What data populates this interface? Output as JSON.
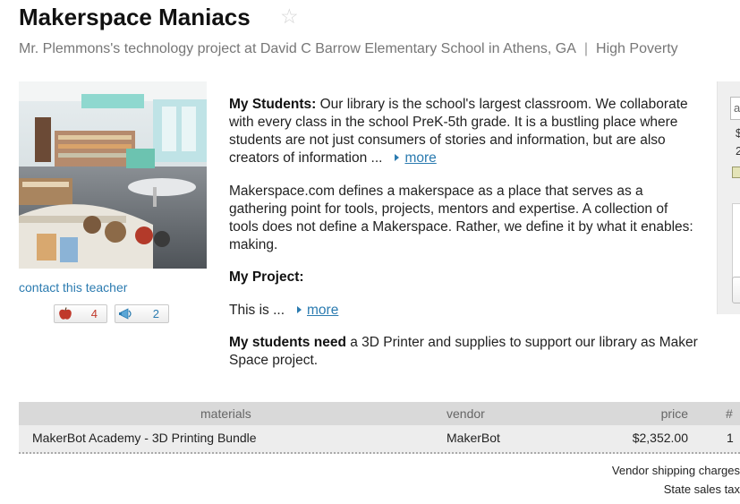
{
  "project": {
    "title": "Makerspace Maniacs",
    "subtitle": "Mr. Plemmons's technology project at David C Barrow Elementary School in Athens, GA",
    "poverty": "High Poverty"
  },
  "teacher": {
    "contact_label": "contact this teacher",
    "apples_count": "4",
    "shares_count": "2"
  },
  "description": {
    "students_heading": "My Students:",
    "students_text": " Our library is the school's largest classroom. We collaborate with every class in the school PreK-5th grade. It is a bustling place where students are not just consumers of stories and information, but are also creators of information ...",
    "more_label": "more",
    "makerspace_text": "Makerspace.com defines a makerspace as a place that serves as a gathering point for tools, projects, mentors and expertise. A collection of tools does not define a Makerspace. Rather, we define it by what it enables: making.",
    "project_heading": "My Project:",
    "project_text": "This is ...",
    "need_heading": "My students need",
    "need_text": " a 3D Printer and supplies to support our library as Maker Space project."
  },
  "sidebar": {
    "input_value": "a",
    "line1": "$",
    "line2": "2"
  },
  "materials_table": {
    "headers": {
      "materials": "materials",
      "vendor": "vendor",
      "price": "price",
      "qty": "#"
    },
    "rows": [
      {
        "material": "MakerBot Academy - 3D Printing Bundle",
        "vendor": "MakerBot",
        "price": "$2,352.00",
        "qty": "1"
      }
    ],
    "footer": {
      "shipping_label": "Vendor shipping charges",
      "tax_label": "State sales tax"
    }
  }
}
